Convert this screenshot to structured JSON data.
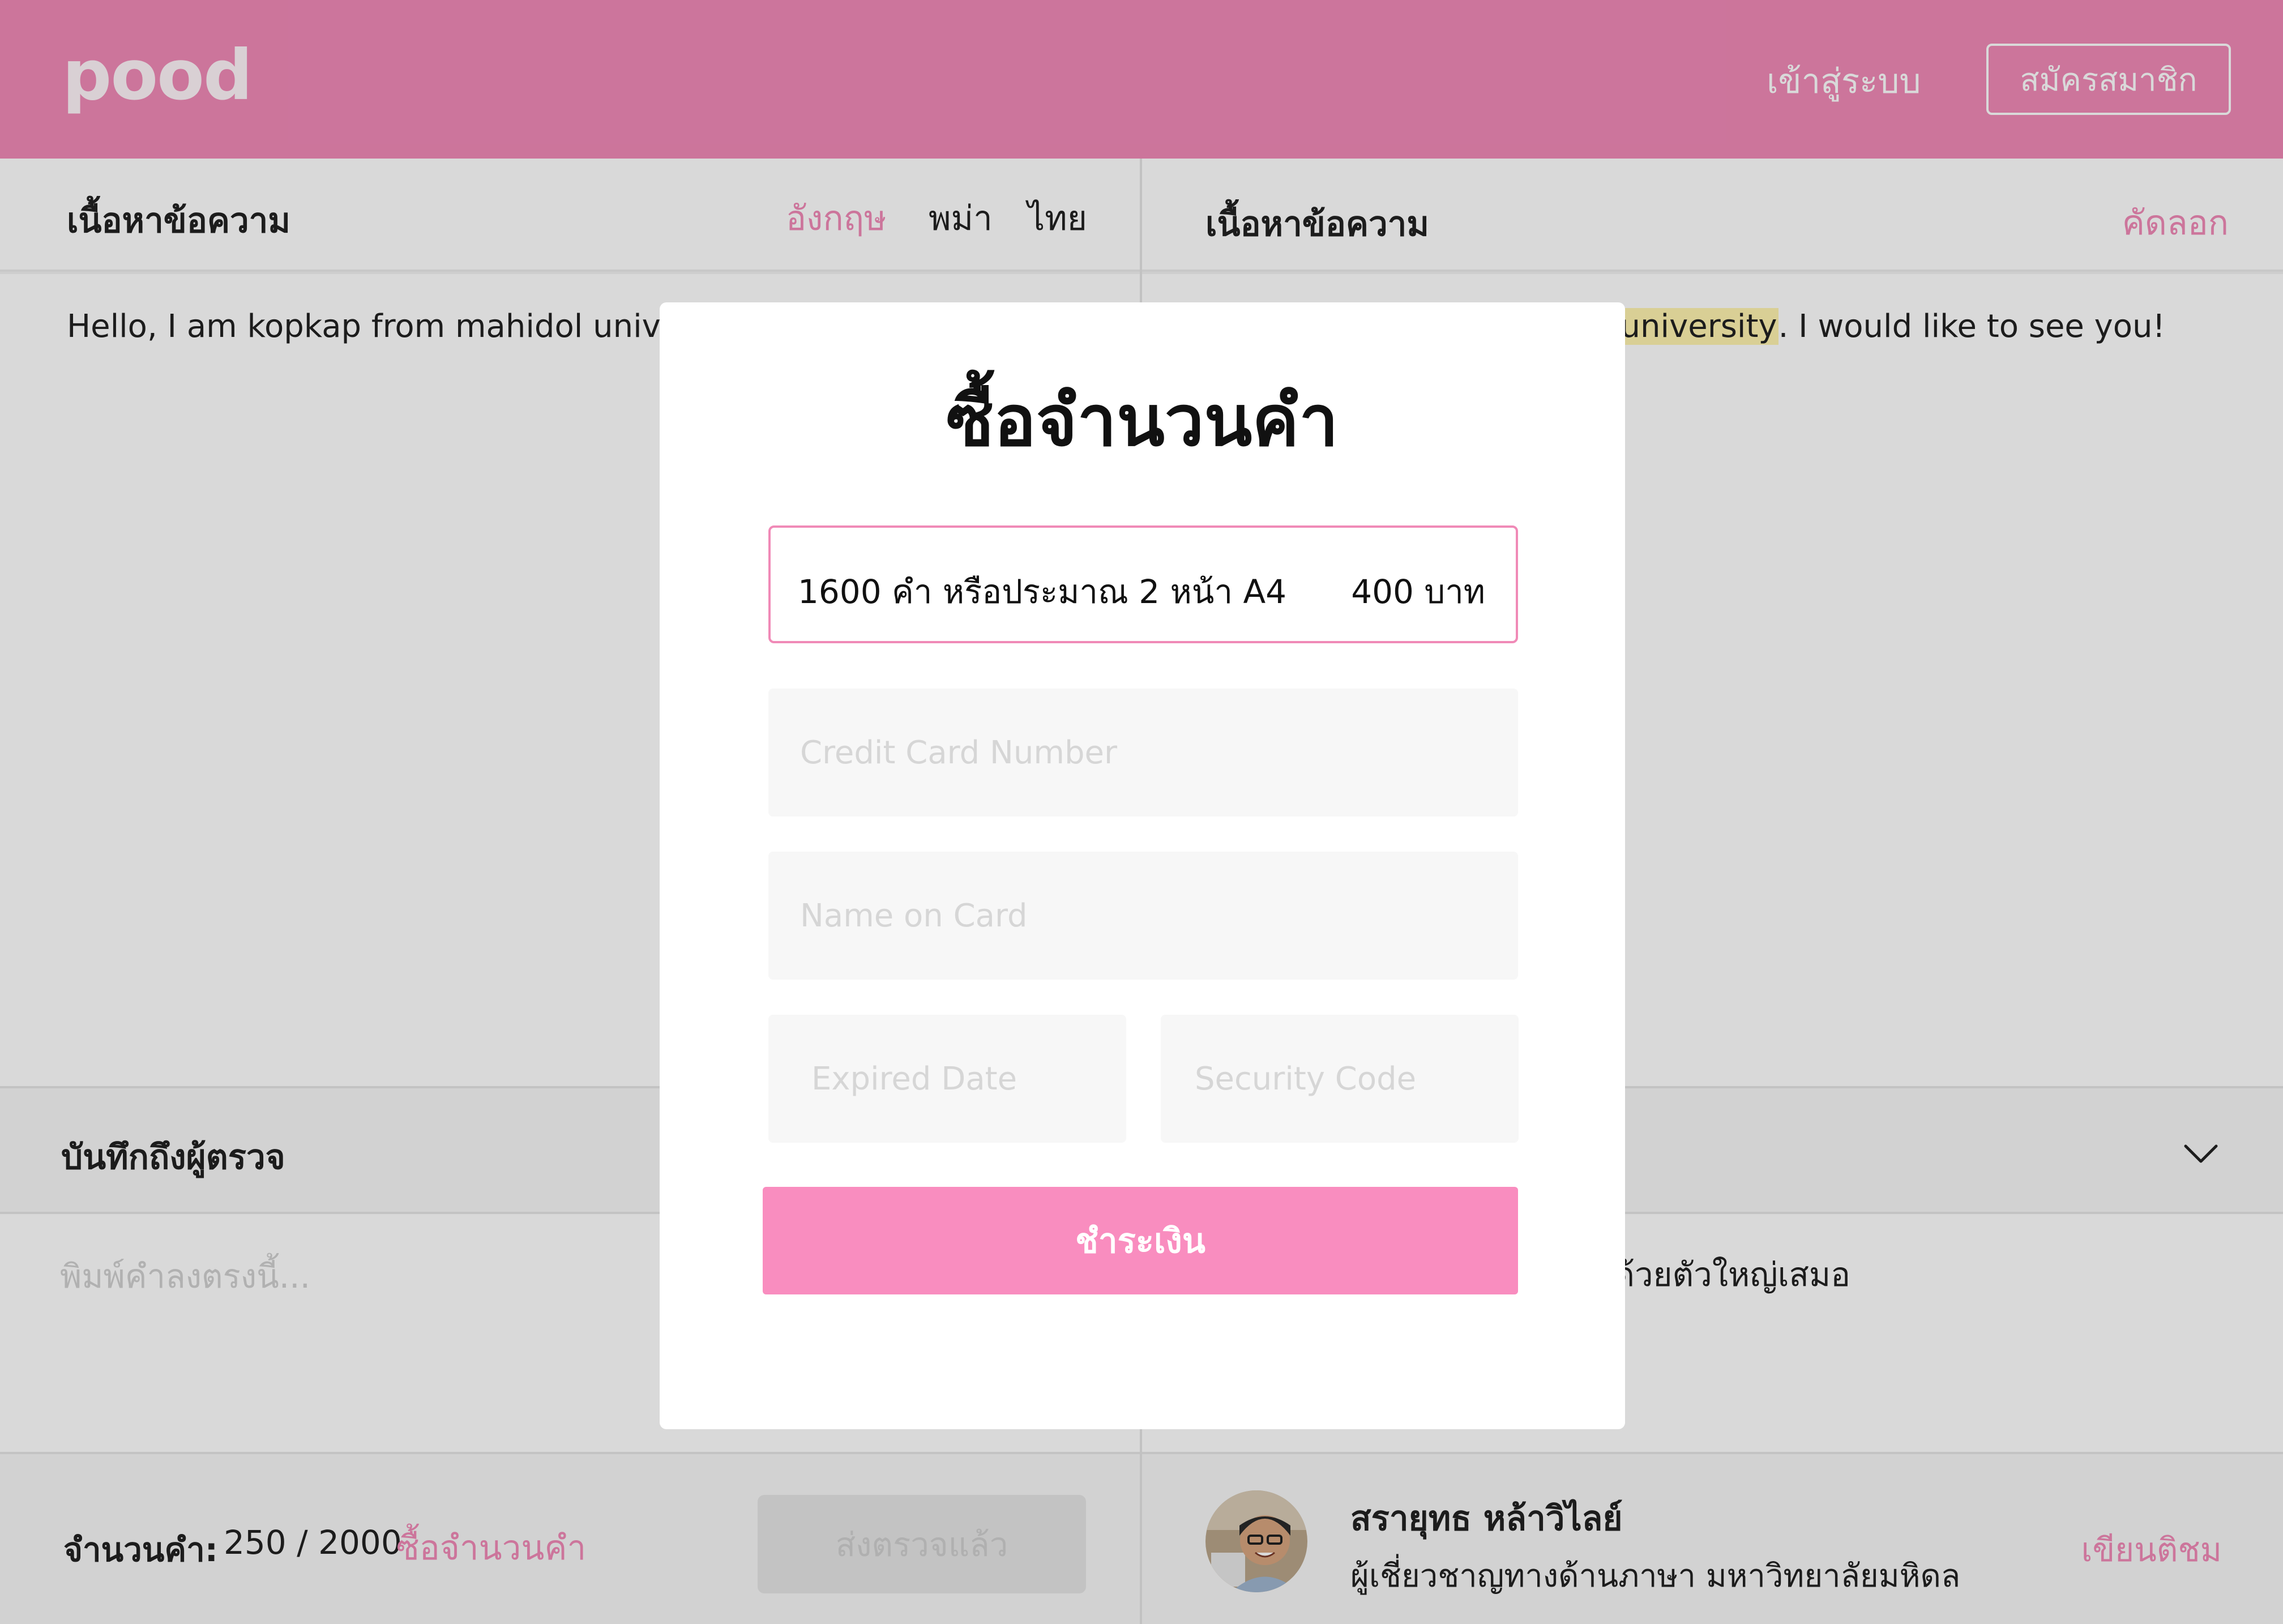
{
  "header": {
    "logo": "pood",
    "login_label": "เข้าสู่ระบบ",
    "register_label": "สมัครสมาชิก"
  },
  "left_panel": {
    "title": "เนื้อหาข้อความ",
    "tabs": [
      {
        "label": "อังกฤษ",
        "active": true
      },
      {
        "label": "พม่า",
        "active": false
      },
      {
        "label": "ไทย",
        "active": false
      }
    ],
    "source_text": "Hello, I am kopkap from mahidol universit",
    "notes_title": "บันทึกถึงผู้ตรวจ",
    "notes_placeholder": "พิมพ์คำลงตรงนี้...",
    "word_count_label": "จำนวนคำ:",
    "word_count": "250 / 2000",
    "buy_words_link": "ซื้อจำนวนคำ",
    "send_button": "ส่งตรวจแล้ว"
  },
  "right_panel": {
    "title": "เนื้อหาข้อความ",
    "copy_label": "คัดลอก",
    "result_highlight": "dol university",
    "result_rest": ". I would like to see you!",
    "reviewer_note": "ด้วยตัวใหญ่เสมอ",
    "reviewer": {
      "name": "สรายุทธ หล้าวิไลย์",
      "title": "ผู้เชี่ยวชาญทางด้านภาษา มหาวิทยาลัยมหิดล"
    },
    "comment_link": "เขียนติชม"
  },
  "modal": {
    "title": "ซื้อจำนวนคำ",
    "package": {
      "description": "1600 คำ หรือประมาณ 2 หน้า A4",
      "price": "400 บาท"
    },
    "card_number_placeholder": "Credit Card Number",
    "name_placeholder": "Name on Card",
    "expiry_placeholder": "Expired Date",
    "security_placeholder": "Security Code",
    "pay_button": "ชำระเงิน"
  },
  "colors": {
    "brand": "#f08ab7",
    "pay_button": "#f98dbf",
    "highlight": "#fff4b0"
  }
}
